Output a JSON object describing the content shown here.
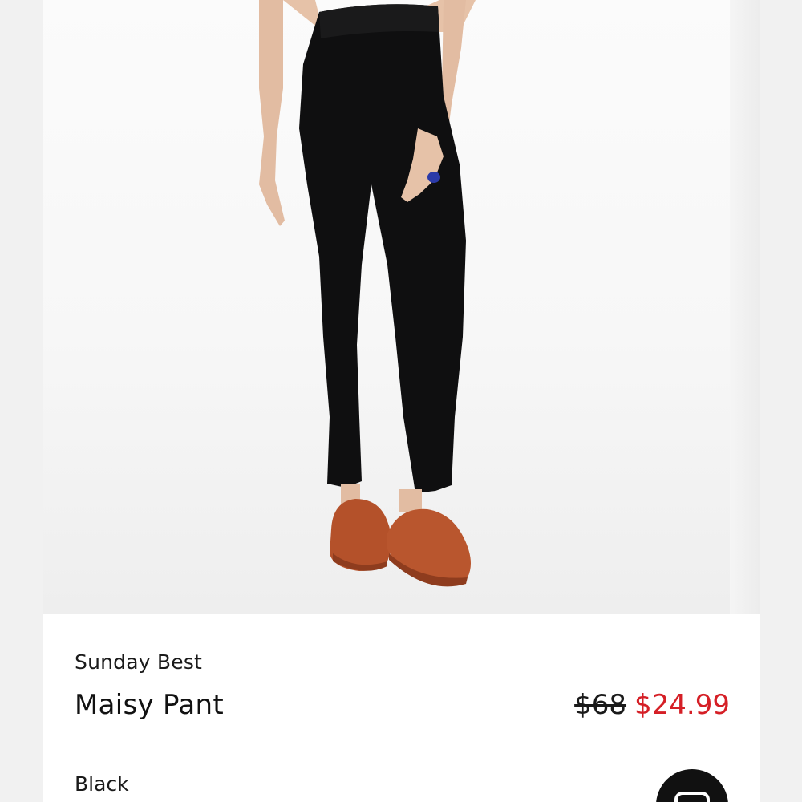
{
  "hero_image": {
    "alt_icon": "product-photo",
    "colors": {
      "pants": "#0f0f10",
      "skin": "#e6c2a8",
      "clogs": "#b4512a",
      "ring": "#2b3aa8",
      "background": "#f7f7f7"
    }
  },
  "product": {
    "brand": "Sunday Best",
    "name": "Maisy Pant",
    "original_price": "$68",
    "sale_price": "$24.99",
    "color": "Black"
  },
  "actions": {
    "fab_icon": "bag-icon"
  },
  "colors": {
    "sale": "#d51f26",
    "text": "#111111",
    "fab": "#111111"
  }
}
